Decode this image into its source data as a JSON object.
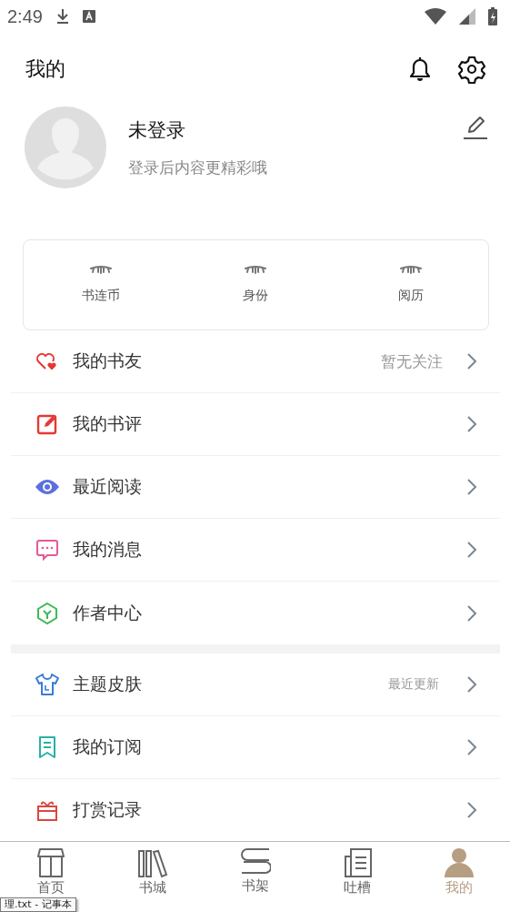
{
  "status_bar": {
    "time": "2:49"
  },
  "header": {
    "title": "我的"
  },
  "profile": {
    "name": "未登录",
    "subtitle": "登录后内容更精彩哦"
  },
  "stats": [
    {
      "label": "书连币"
    },
    {
      "label": "身份"
    },
    {
      "label": "阅历"
    }
  ],
  "menu_groups": [
    {
      "items": [
        {
          "kind": "friends",
          "label": "我的书友",
          "detail": "暂无关注"
        },
        {
          "kind": "review",
          "label": "我的书评"
        },
        {
          "kind": "recent",
          "label": "最近阅读"
        },
        {
          "kind": "messages",
          "label": "我的消息"
        },
        {
          "kind": "author",
          "label": "作者中心"
        }
      ]
    },
    {
      "items": [
        {
          "kind": "theme",
          "label": "主题皮肤",
          "detail": "最近更新"
        },
        {
          "kind": "subscription",
          "label": "我的订阅"
        },
        {
          "kind": "reward",
          "label": "打赏记录"
        }
      ]
    }
  ],
  "bottom_nav": [
    {
      "kind": "home",
      "label": "首页",
      "selected": false
    },
    {
      "kind": "store",
      "label": "书城",
      "selected": false
    },
    {
      "kind": "shelf",
      "label": "书架",
      "selected": false
    },
    {
      "kind": "talk",
      "label": "吐槽",
      "selected": false
    },
    {
      "kind": "me",
      "label": "我的",
      "selected": true
    }
  ],
  "tooltip": {
    "text": "理.txt - 记事本"
  }
}
